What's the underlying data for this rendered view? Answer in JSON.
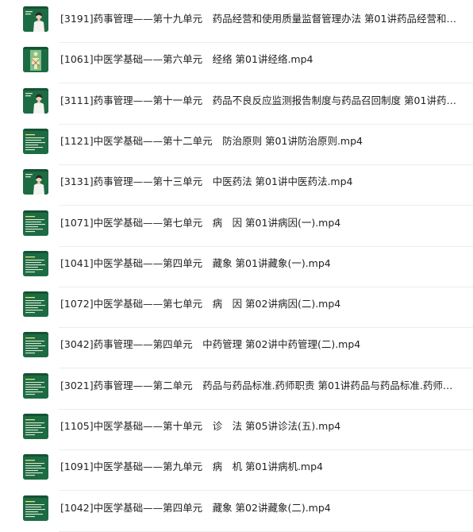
{
  "files": [
    {
      "name": "[3191]药事管理——第十九单元　药品经营和使用质量监督管理办法 第01讲药品经营和使...",
      "thumb": "teacher-woman-icon"
    },
    {
      "name": "[1061]中医学基础——第六单元　经络 第01讲经络.mp4",
      "thumb": "figure-chart-icon"
    },
    {
      "name": "[3111]药事管理——第十一单元　药品不良反应监测报告制度与药品召回制度 第01讲药品...",
      "thumb": "teacher-woman-icon"
    },
    {
      "name": "[1121]中医学基础——第十二单元　防治原则 第01讲防治原则.mp4",
      "thumb": "chalkboard-text-icon"
    },
    {
      "name": "[3131]药事管理——第十三单元　中医药法 第01讲中医药法.mp4",
      "thumb": "teacher-woman-icon"
    },
    {
      "name": "[1071]中医学基础——第七单元　病　因 第01讲病因(一).mp4",
      "thumb": "chalkboard-text-icon"
    },
    {
      "name": "[1041]中医学基础——第四单元　藏象 第01讲藏象(一).mp4",
      "thumb": "chalkboard-text-icon"
    },
    {
      "name": "[1072]中医学基础——第七单元　病　因 第02讲病因(二).mp4",
      "thumb": "chalkboard-text-icon"
    },
    {
      "name": "[3042]药事管理——第四单元　中药管理 第02讲中药管理(二).mp4",
      "thumb": "chalkboard-text-icon"
    },
    {
      "name": "[3021]药事管理——第二单元　药品与药品标准.药师职责 第01讲药品与药品标准.药师职责...",
      "thumb": "chalkboard-text-icon"
    },
    {
      "name": "[1105]中医学基础——第十单元　诊　法 第05讲诊法(五).mp4",
      "thumb": "chalkboard-text-icon"
    },
    {
      "name": "[1091]中医学基础——第九单元　病　机 第01讲病机.mp4",
      "thumb": "chalkboard-text-icon"
    },
    {
      "name": "[1042]中医学基础——第四单元　藏象 第02讲藏象(二).mp4",
      "thumb": "chalkboard-text-icon"
    }
  ],
  "colors": {
    "thumb_bg": "#1f6a44",
    "text": "#222222",
    "divider": "#ececec"
  }
}
